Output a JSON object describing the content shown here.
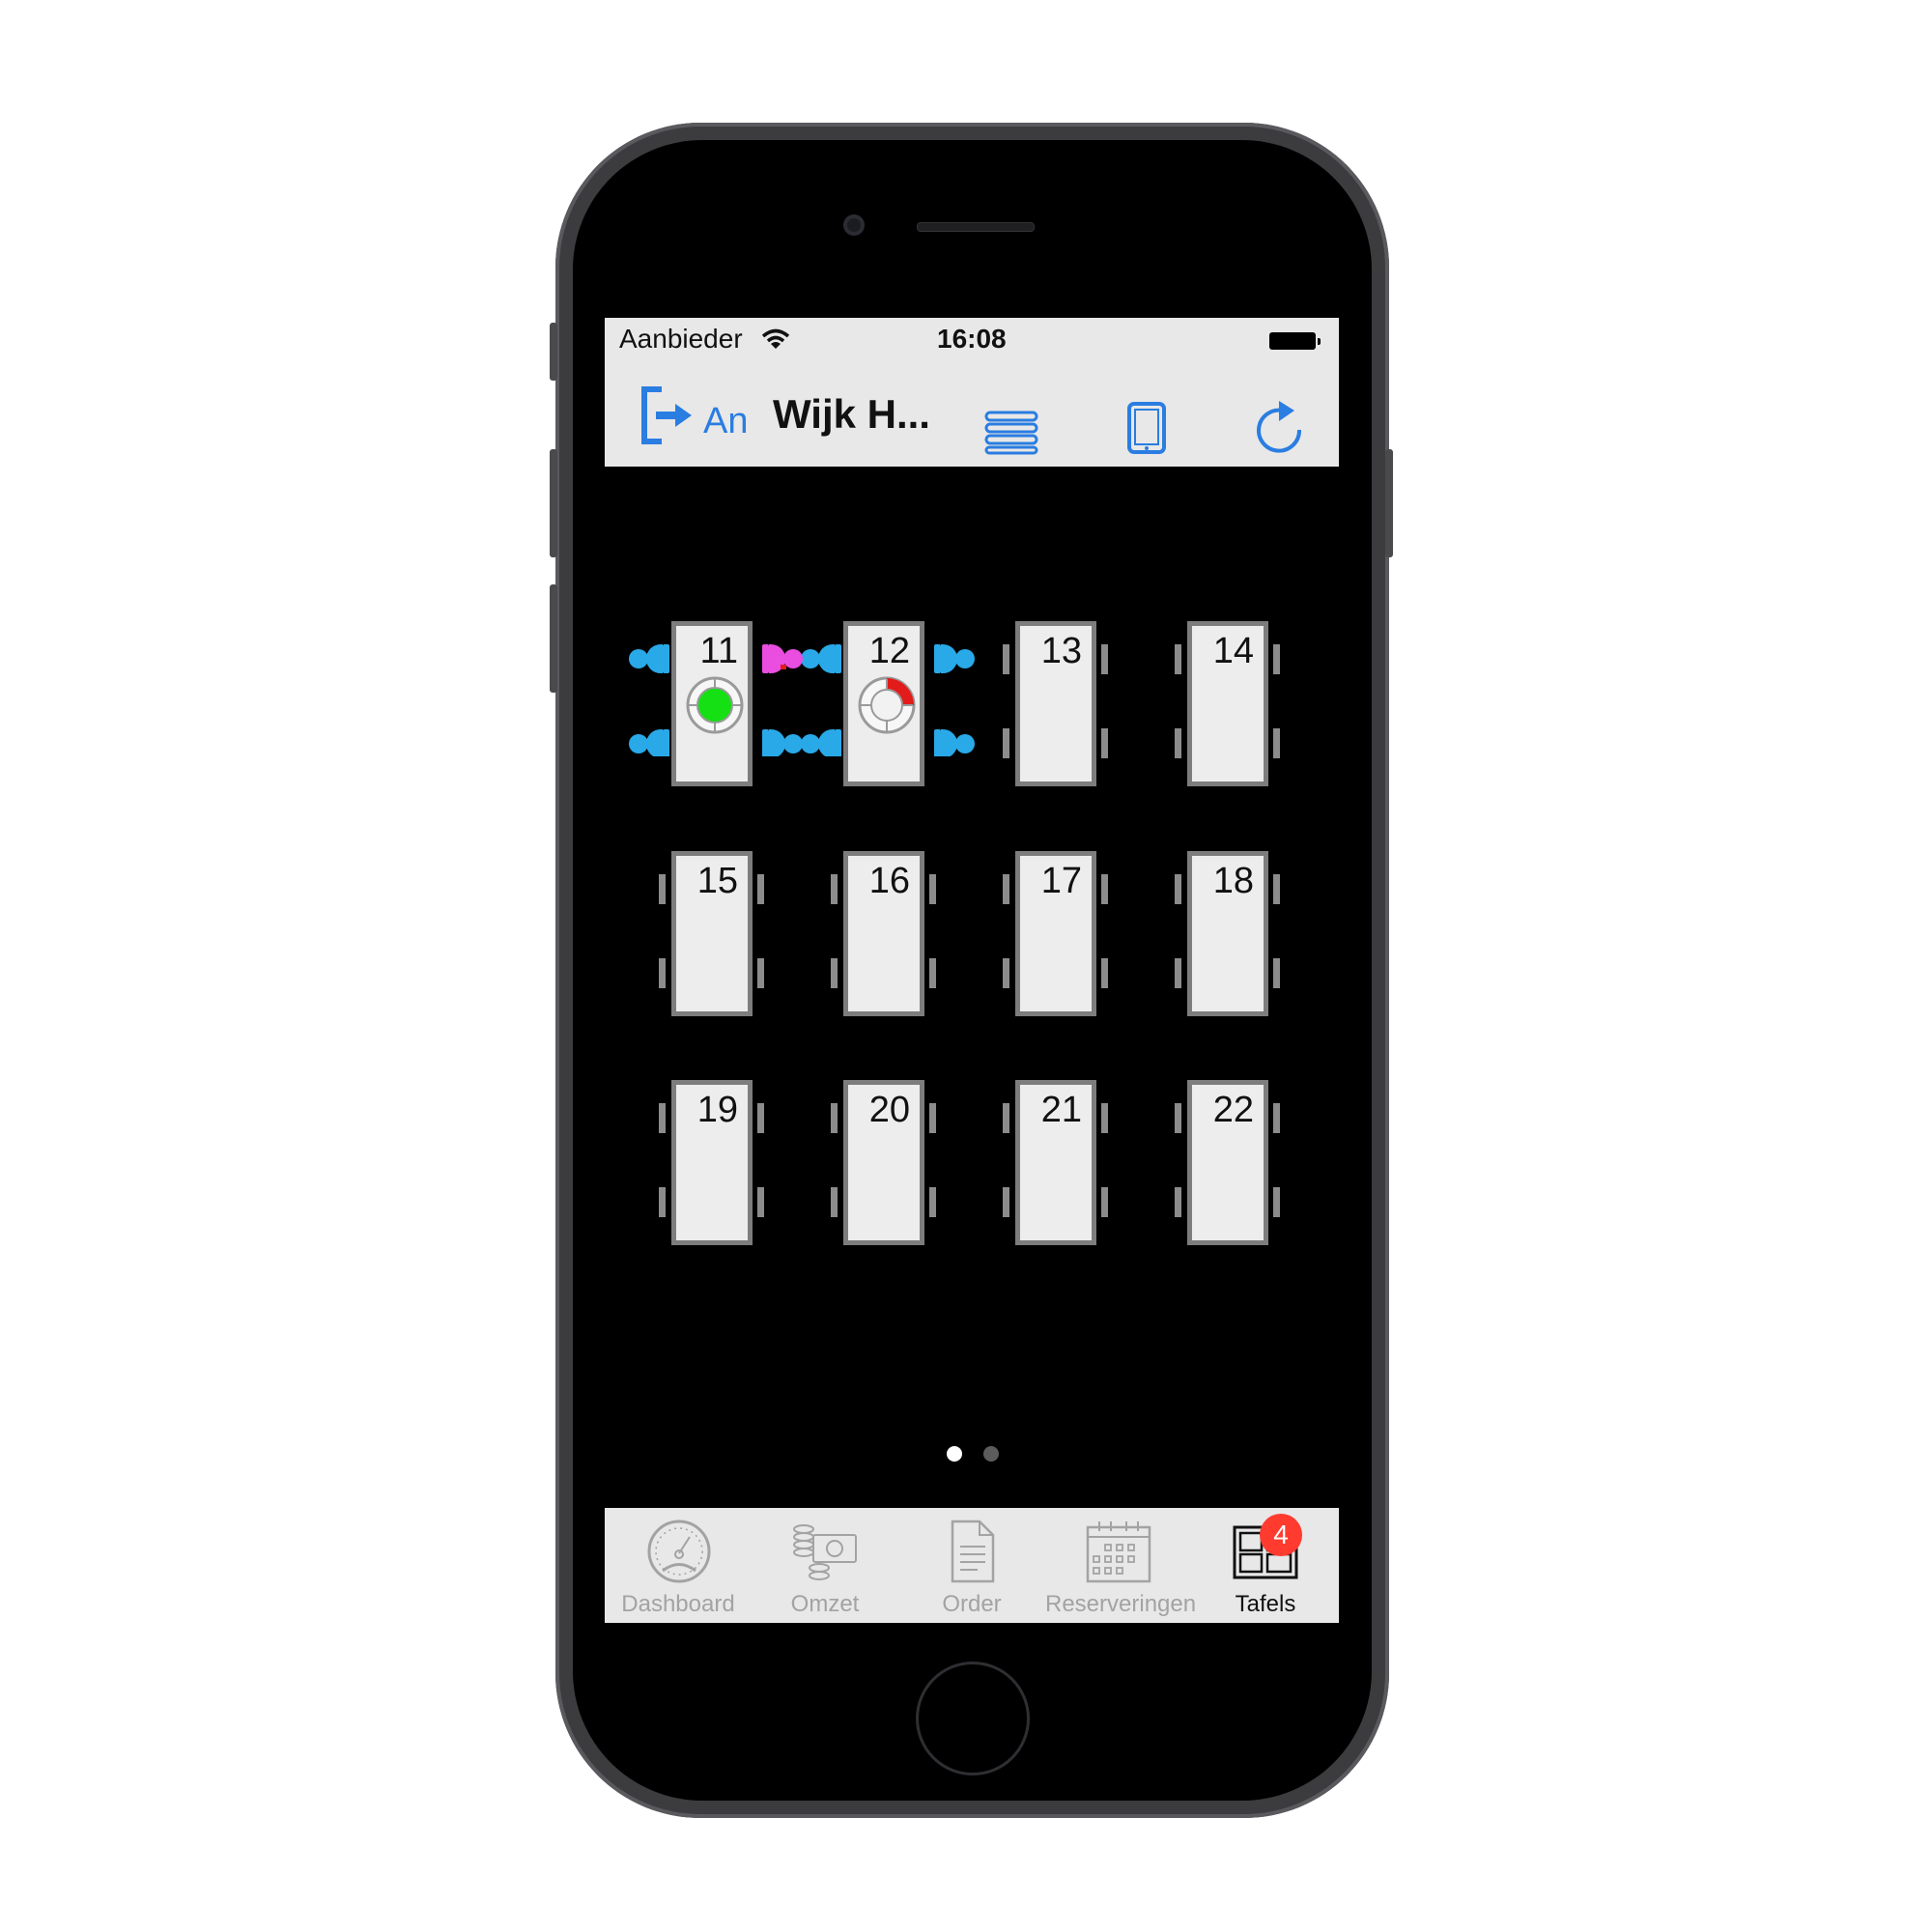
{
  "status_bar": {
    "carrier": "Aanbieder",
    "time": "16:08"
  },
  "nav": {
    "user": "An",
    "venue": "Wijk H..."
  },
  "tables": [
    {
      "number": "11",
      "status": "green"
    },
    {
      "number": "12",
      "status": "partial-red"
    },
    {
      "number": "13",
      "status": "empty"
    },
    {
      "number": "14",
      "status": "empty"
    },
    {
      "number": "15",
      "status": "empty"
    },
    {
      "number": "16",
      "status": "empty"
    },
    {
      "number": "17",
      "status": "empty"
    },
    {
      "number": "18",
      "status": "empty"
    },
    {
      "number": "19",
      "status": "empty"
    },
    {
      "number": "20",
      "status": "empty"
    },
    {
      "number": "21",
      "status": "empty"
    },
    {
      "number": "22",
      "status": "empty"
    }
  ],
  "page_indicator": {
    "pages": 2,
    "current": 1
  },
  "tabs": [
    {
      "label": "Dashboard",
      "icon": "speedometer-icon"
    },
    {
      "label": "Omzet",
      "icon": "coins-icon"
    },
    {
      "label": "Order",
      "icon": "document-icon"
    },
    {
      "label": "Reserveringen",
      "icon": "calendar-icon"
    },
    {
      "label": "Tafels",
      "icon": "tables-icon",
      "badge": "4",
      "active": true
    }
  ],
  "colors": {
    "accent": "#2a7de1",
    "guest": "#29a9e8",
    "alert": "#e94ee0",
    "badge": "#ff3b30",
    "occupied": "#14e014",
    "pending": "#e21b1b"
  }
}
